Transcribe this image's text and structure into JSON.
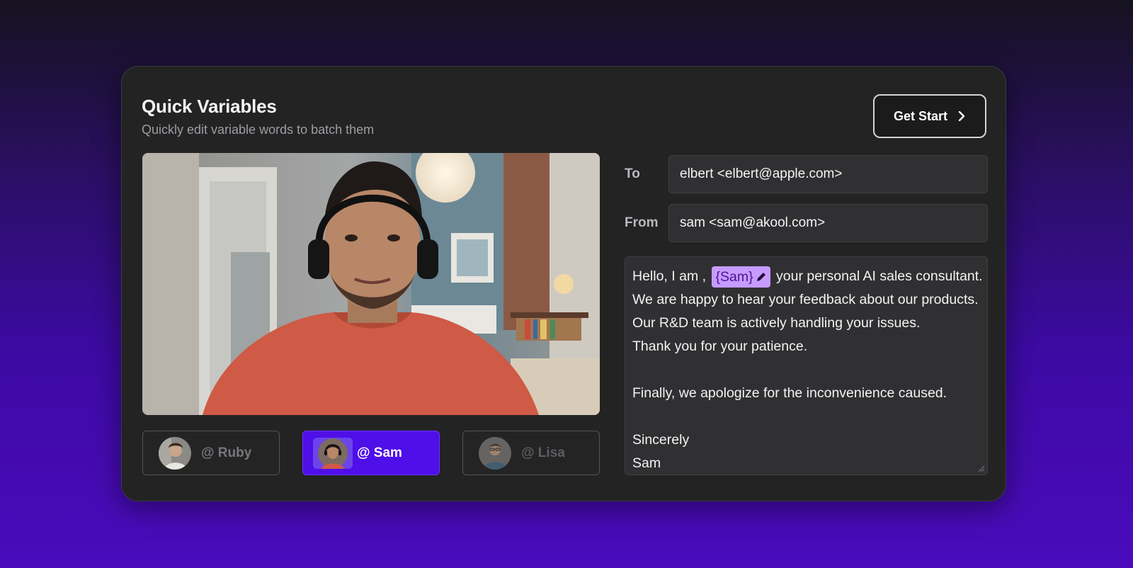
{
  "header": {
    "title": "Quick Variables",
    "subtitle": "Quickly edit variable words to batch them",
    "cta_label": "Get Start",
    "cta_icon": "chevron-right-icon"
  },
  "avatars": [
    {
      "label": "@ Ruby",
      "icon": "avatar-ruby",
      "state": "inactive"
    },
    {
      "label": "@ Sam",
      "icon": "avatar-sam",
      "state": "active"
    },
    {
      "label": "@ Lisa",
      "icon": "avatar-lisa",
      "state": "dim"
    }
  ],
  "form": {
    "to_label": "To",
    "to_value": "elbert <elbert@apple.com>",
    "from_label": "From",
    "from_value": "sam <sam@akool.com>"
  },
  "message": {
    "line1_prefix": "Hello, I am ,",
    "variable": "{Sam}",
    "variable_icon": "pencil-icon",
    "line1_suffix": "your personal AI sales consultant.",
    "line2": "We are happy to hear your feedback about our products.",
    "line3": "Our R&D team is actively handling your issues.",
    "line4": "Thank you for your patience.",
    "line5": "Finally, we apologize for the inconvenience caused.",
    "line6": "Sincerely",
    "line7": "Sam"
  },
  "colors": {
    "accent": "#4f0fe8",
    "variable_bg": "#c79bff",
    "panel_bg": "#232324"
  }
}
